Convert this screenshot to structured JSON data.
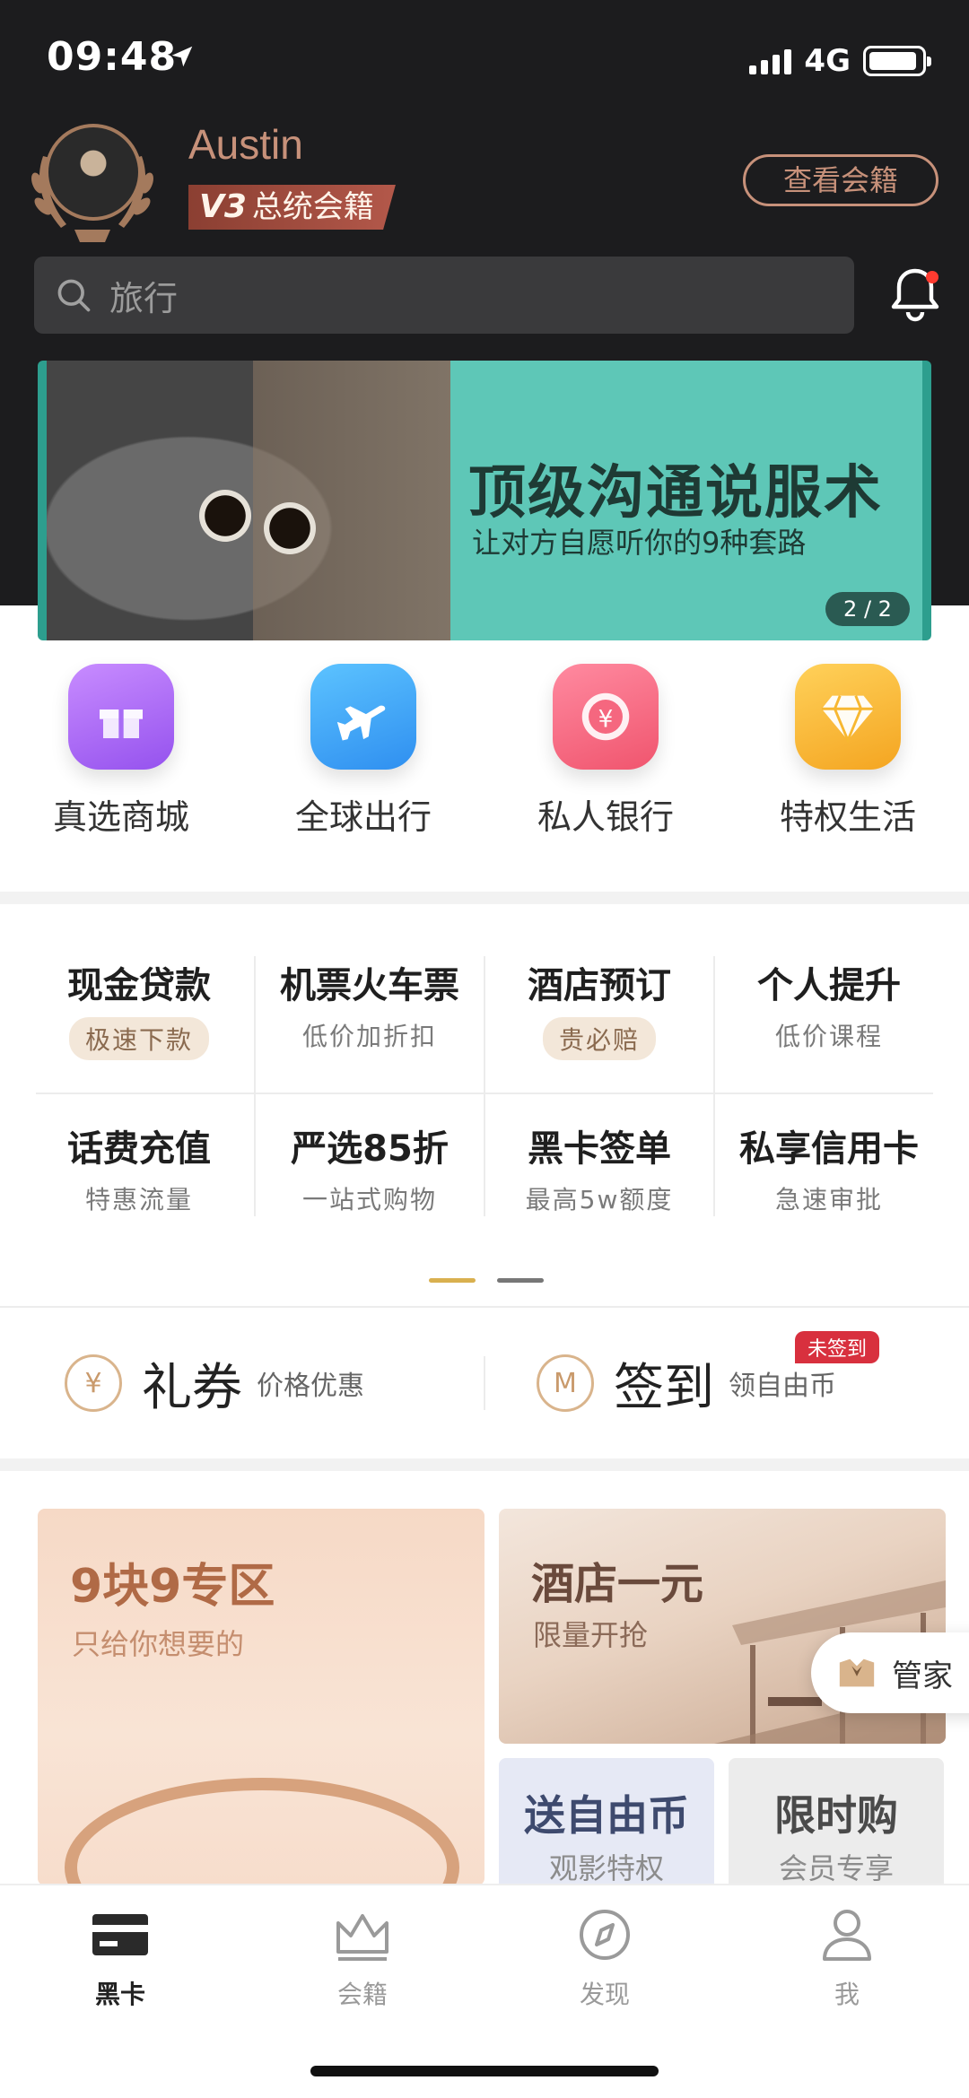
{
  "status_bar": {
    "time": "09:48",
    "network": "4G"
  },
  "profile": {
    "username": "Austin",
    "vip_level": "V3",
    "vip_tier": "总统会籍",
    "view_membership": "查看会籍"
  },
  "search": {
    "placeholder": "旅行"
  },
  "banner": {
    "title": "顶级沟通说服术",
    "subtitle": "让对方自愿听你的9种套路",
    "pager": "2 / 2"
  },
  "quick_icons": [
    {
      "label": "真选商城",
      "icon": "gift-icon",
      "color": "#a86cf5"
    },
    {
      "label": "全球出行",
      "icon": "airplane-icon",
      "color": "#3fa2f5"
    },
    {
      "label": "私人银行",
      "icon": "yen-coin-icon",
      "color": "#f5677f"
    },
    {
      "label": "特权生活",
      "icon": "diamond-icon",
      "color": "#f7b731"
    }
  ],
  "services": [
    {
      "title": "现金贷款",
      "sub": "极速下款",
      "pill": true
    },
    {
      "title": "机票火车票",
      "sub": "低价加折扣",
      "pill": false
    },
    {
      "title": "酒店预订",
      "sub": "贵必赔",
      "pill": true
    },
    {
      "title": "个人提升",
      "sub": "低价课程",
      "pill": false
    },
    {
      "title": "话费充值",
      "sub": "特惠流量",
      "pill": false
    },
    {
      "title": "严选85折",
      "sub": "一站式购物",
      "pill": false
    },
    {
      "title": "黑卡签单",
      "sub": "最高5w额度",
      "pill": false
    },
    {
      "title": "私享信用卡",
      "sub": "急速审批",
      "pill": false
    }
  ],
  "coupon": {
    "title": "礼券",
    "sub": "价格优惠",
    "icon_text": "¥"
  },
  "signin": {
    "title": "签到",
    "sub": "领自由币",
    "badge": "未签到",
    "icon_text": "M"
  },
  "promos": {
    "big": {
      "title": "9块9专区",
      "sub": "只给你想要的"
    },
    "hotel": {
      "title": "酒店一元",
      "sub": "限量开抢"
    },
    "coins": {
      "title": "送自由币",
      "sub": "观影特权"
    },
    "flash": {
      "title": "限时购",
      "sub": "会员专享"
    }
  },
  "butler": {
    "label": "管家"
  },
  "tabs": [
    {
      "label": "黑卡",
      "icon": "black-card-icon",
      "active": true
    },
    {
      "label": "会籍",
      "icon": "crown-icon",
      "active": false
    },
    {
      "label": "发现",
      "icon": "compass-icon",
      "active": false
    },
    {
      "label": "我",
      "icon": "person-icon",
      "active": false
    }
  ],
  "colors": {
    "header_bg": "#1c1c1e",
    "accent_copper": "#c7917a",
    "active_dot": "#d9b04f",
    "badge_red": "#d8303e"
  }
}
